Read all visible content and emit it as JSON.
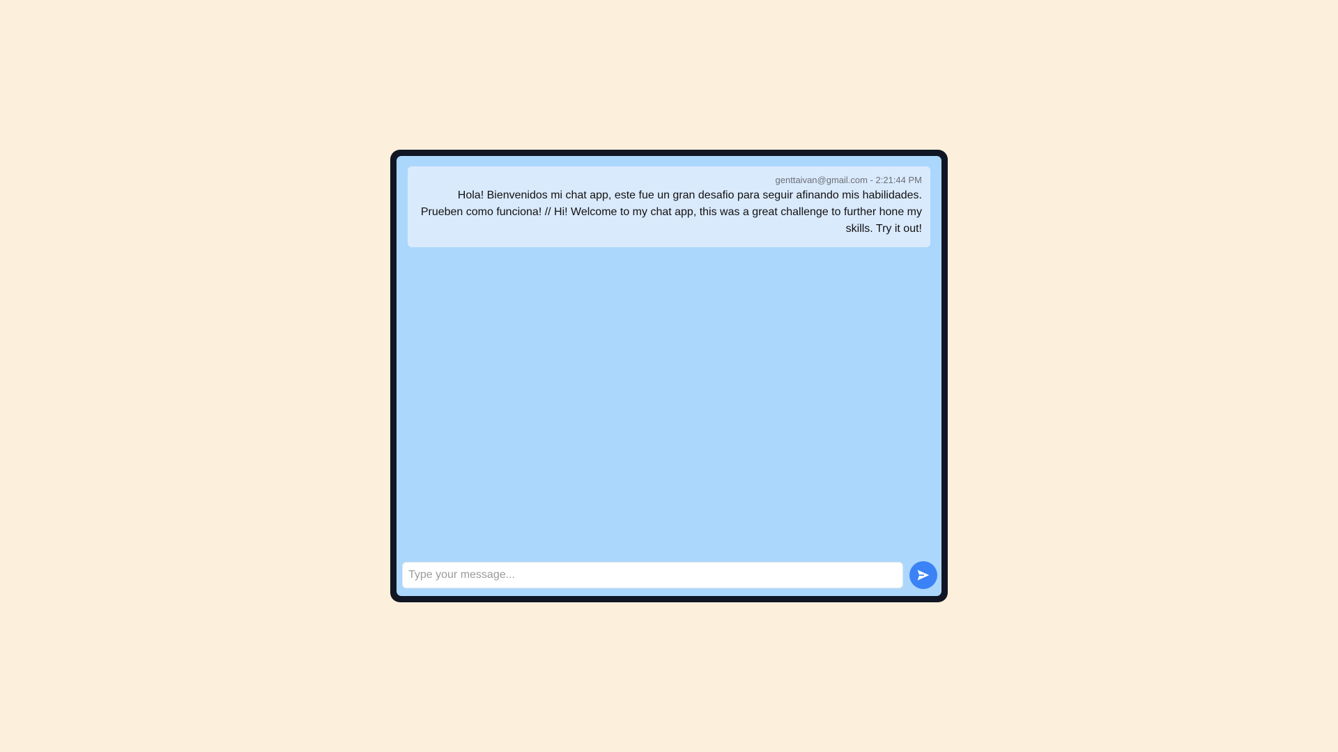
{
  "messages": [
    {
      "author": "genttaivan@gmail.com",
      "time": "2:21:44 PM",
      "meta": "genttaivan@gmail.com - 2:21:44 PM",
      "text": "Hola! Bienvenidos mi chat app, este fue un gran desafio para seguir afinando mis habilidades. Prueben como funciona! // Hi! Welcome to my chat app, this was a great challenge to further hone my skills. Try it out!"
    }
  ],
  "composer": {
    "placeholder": "Type your message...",
    "value": "",
    "send_icon": "send-icon"
  },
  "colors": {
    "page_background": "#fcf0dc",
    "frame": "#101624",
    "chat_background": "#acd7fc",
    "message_bubble": "#daeafd",
    "send_button": "#3b82f6"
  }
}
